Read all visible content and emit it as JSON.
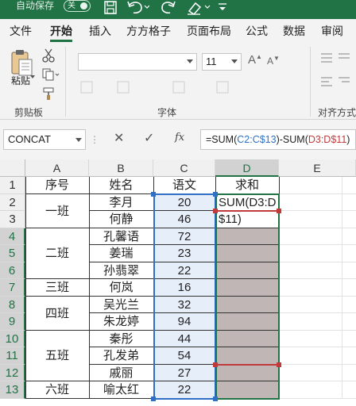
{
  "titlebar": {
    "autosave_label": "自动保存",
    "toggle_label": "关"
  },
  "ribbon_tabs": [
    "文件",
    "开始",
    "插入",
    "方方格子",
    "页面布局",
    "公式",
    "数据",
    "审阅"
  ],
  "ribbon": {
    "paste_label": "粘贴",
    "clipboard_label": "剪贴板",
    "font_group_label": "字体",
    "font_size_value": "11",
    "alignment_group_label": "对齐方式"
  },
  "formula_bar": {
    "name_box": "CONCAT",
    "fx_label": "fx",
    "formula_parts": [
      "=SUM(",
      "C2:C$13",
      ")-SUM(",
      "D3:D$11",
      ")"
    ]
  },
  "sheet": {
    "columns": [
      "A",
      "B",
      "C",
      "D",
      "E"
    ],
    "rows": [
      "1",
      "2",
      "3",
      "4",
      "5",
      "6",
      "7",
      "8",
      "9",
      "10",
      "11",
      "12",
      "13"
    ],
    "header": {
      "A": "序号",
      "B": "姓名",
      "C": "语文",
      "D": "求和"
    },
    "classes": [
      {
        "label": "一班",
        "from": 2,
        "to": 3
      },
      {
        "label": "二班",
        "from": 4,
        "to": 6
      },
      {
        "label": "三班",
        "from": 7,
        "to": 7
      },
      {
        "label": "四班",
        "from": 8,
        "to": 9
      },
      {
        "label": "五班",
        "from": 10,
        "to": 12
      },
      {
        "label": "六班",
        "from": 13,
        "to": 13
      }
    ],
    "students": [
      {
        "name": "李月",
        "score": "20"
      },
      {
        "name": "何静",
        "score": "46"
      },
      {
        "name": "孔馨语",
        "score": "72"
      },
      {
        "name": "姜瑞",
        "score": "23"
      },
      {
        "name": "孙翡翠",
        "score": "22"
      },
      {
        "name": "何岚",
        "score": "16"
      },
      {
        "name": "吴光兰",
        "score": "32"
      },
      {
        "name": "朱龙婷",
        "score": "94"
      },
      {
        "name": "秦彤",
        "score": "44"
      },
      {
        "name": "孔发弟",
        "score": "54"
      },
      {
        "name": "戚丽",
        "score": "27"
      },
      {
        "name": "喻太红",
        "score": "22"
      }
    ],
    "editing_text_line1": "SUM(D3:D",
    "editing_text_line2": "$11)"
  },
  "colors": {
    "accent": "#217346",
    "range_blue": "#2f6fc6",
    "range_red": "#c0393b",
    "selection_fill": "#c0b6b5",
    "blue_fill": "#e6eef9"
  }
}
